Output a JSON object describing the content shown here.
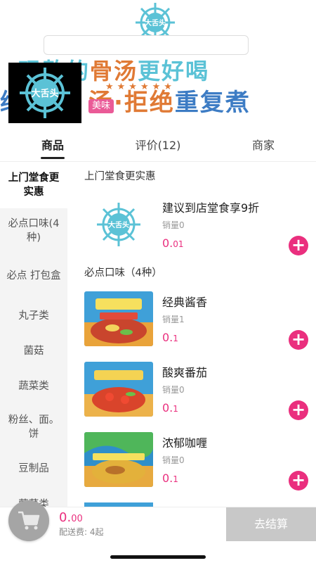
{
  "banner": {
    "logo_text": "大舌头",
    "slogan_line1_a": "现熬的",
    "slogan_line1_b": "骨汤",
    "slogan_line1_c": "更好喝",
    "slogan_line2_a": "绿",
    "slogan_line2_b": "汤·拒绝",
    "slogan_line2_c": "重复煮",
    "stars": "★★★★★★",
    "tag": "美味"
  },
  "tabs": [
    {
      "label": "商品"
    },
    {
      "label": "评价(12)"
    },
    {
      "label": "商家"
    }
  ],
  "categories": [
    {
      "label": "上门堂食更实惠"
    },
    {
      "label": "必点口味(4种)"
    },
    {
      "label": "必点 打包盒"
    },
    {
      "label": "丸子类"
    },
    {
      "label": "菌菇"
    },
    {
      "label": "蔬菜类"
    },
    {
      "label": "粉丝、面。饼"
    },
    {
      "label": "豆制品"
    },
    {
      "label": "荤菜类"
    }
  ],
  "sections": [
    {
      "title": "上门堂食更实惠",
      "products": [
        {
          "name": "建议到店堂食享9折",
          "sales": "销量0",
          "price_int": "0.",
          "price_dec": "01"
        }
      ]
    },
    {
      "title": "必点口味（4种）",
      "products": [
        {
          "name": "经典酱香",
          "sales": "销量1",
          "price_int": "0.",
          "price_dec": "1"
        },
        {
          "name": "酸爽番茄",
          "sales": "销量0",
          "price_int": "0.",
          "price_dec": "1"
        },
        {
          "name": "浓郁咖喱",
          "sales": "销量0",
          "price_int": "0.",
          "price_dec": "1"
        }
      ]
    }
  ],
  "cart": {
    "total_int": "0.",
    "total_dec": "00",
    "delivery_fee": "配送费: 4起",
    "checkout_label": "去结算"
  },
  "icons": {
    "add": "plus-icon",
    "cart": "cart-icon",
    "logo": "ship-wheel-icon"
  },
  "colors": {
    "accent": "#ea2f7e",
    "tag": "#ea5a97",
    "logo_blue": "#5bc2d6",
    "checkout_disabled": "#c8c8c8"
  }
}
